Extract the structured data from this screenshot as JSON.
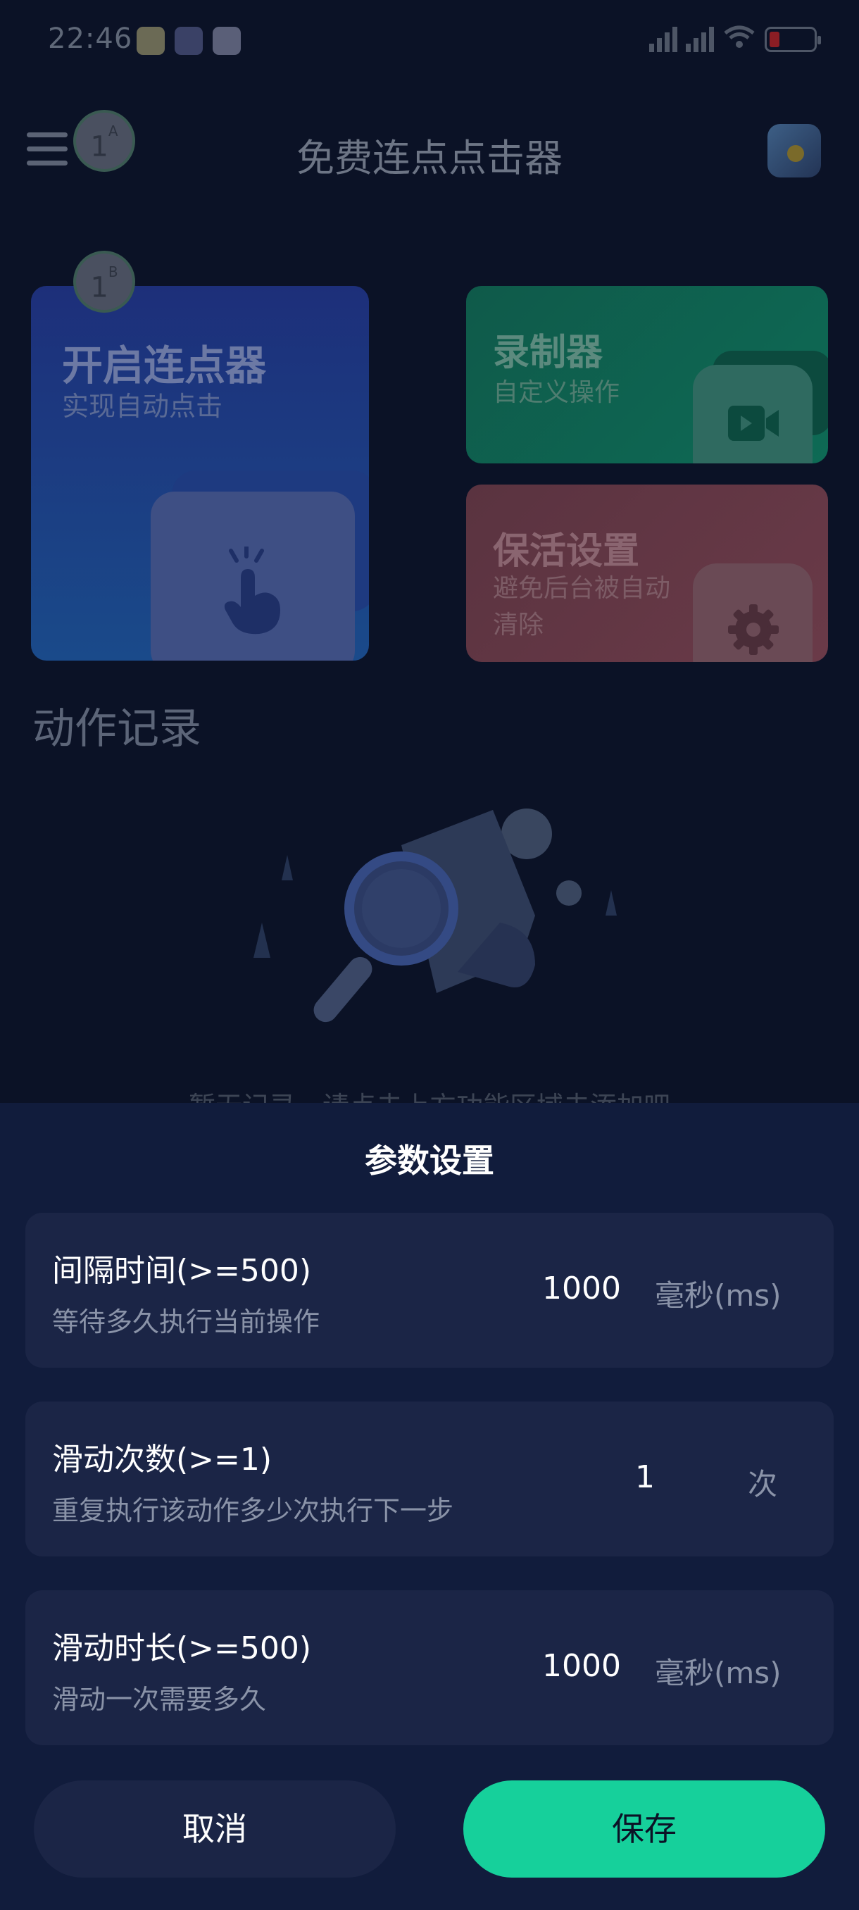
{
  "status": {
    "time": "22:46",
    "battery_level": "15"
  },
  "header": {
    "title": "免费连点点击器",
    "marker_a": "1",
    "marker_a_sup": "A",
    "marker_b": "1",
    "marker_b_sup": "B"
  },
  "cards": {
    "start": {
      "title": "开启连点器",
      "subtitle": "实现自动点击"
    },
    "recorder": {
      "title": "录制器",
      "subtitle": "自定义操作"
    },
    "keepalive": {
      "title": "保活设置",
      "subtitle": "避免后台被自动清除"
    }
  },
  "records": {
    "section_title": "动作记录",
    "empty_text": "暂无记录，请点击上方功能区域去添加吧"
  },
  "sheet": {
    "title": "参数设置",
    "params": [
      {
        "label": "间隔时间(>=500)",
        "description": "等待多久执行当前操作",
        "value": "1000",
        "unit": "毫秒(ms)"
      },
      {
        "label": "滑动次数(>=1)",
        "description": "重复执行该动作多少次执行下一步",
        "value": "1",
        "unit": "次"
      },
      {
        "label": "滑动时长(>=500)",
        "description": "滑动一次需要多久",
        "value": "1000",
        "unit": "毫秒(ms)"
      }
    ],
    "cancel_label": "取消",
    "save_label": "保存"
  },
  "colors": {
    "background": "#0b1226",
    "sheet": "#111c3c",
    "row": "#1b2546",
    "accent": "#16d09b"
  },
  "icons": [
    "menu-icon",
    "avatar-icon",
    "tap-hand-icon",
    "video-camera-icon",
    "gear-icon",
    "magnifier-document-icon"
  ]
}
